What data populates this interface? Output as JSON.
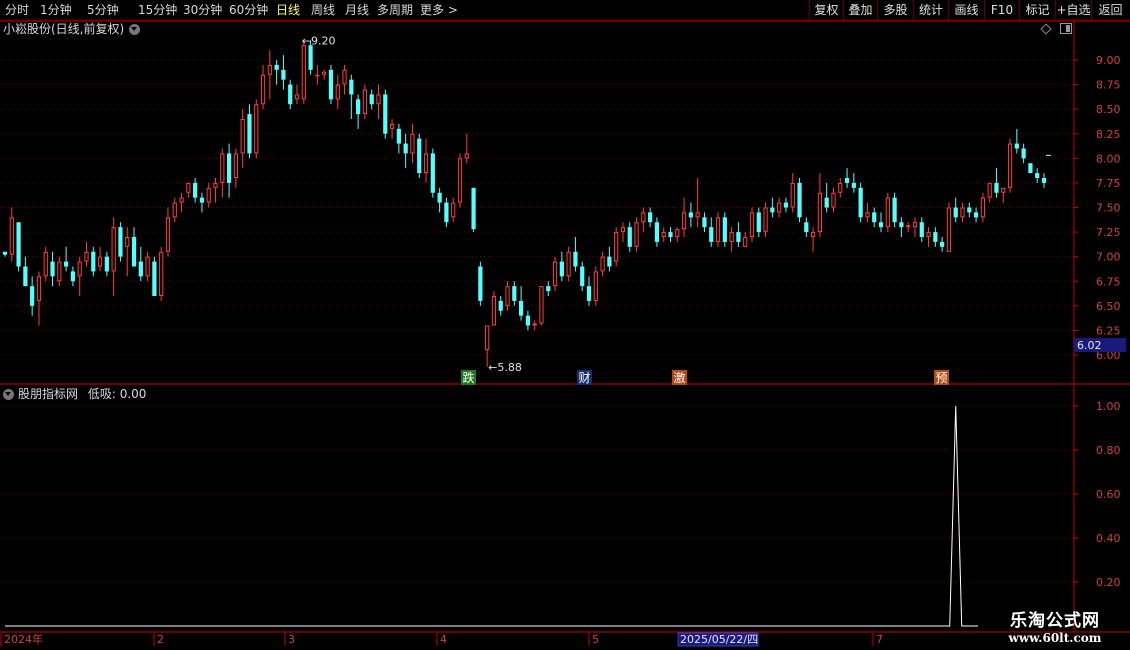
{
  "toolbar": {
    "periods": [
      {
        "label": "分时"
      },
      {
        "label": "1分钟"
      },
      {
        "label": "5分钟"
      },
      {
        "label": "15分钟"
      },
      {
        "label": "30分钟"
      },
      {
        "label": "60分钟"
      },
      {
        "label": "日线",
        "active": true
      },
      {
        "label": "周线"
      },
      {
        "label": "月线"
      },
      {
        "label": "多周期"
      },
      {
        "label": "更多 >"
      }
    ],
    "right_buttons": [
      {
        "label": "复权"
      },
      {
        "label": "叠加"
      },
      {
        "label": "多股"
      },
      {
        "label": "统计"
      },
      {
        "label": "画线"
      },
      {
        "label": "F10"
      },
      {
        "label": "标记"
      },
      {
        "label": "+自选"
      },
      {
        "label": "返回"
      }
    ]
  },
  "main_panel": {
    "title": "小崧股份(日线,前复权)",
    "high_label": "9.20",
    "low_label": "5.88",
    "current_price_tag": "6.02",
    "markers": [
      {
        "text": "跌",
        "bg": "#1f7a1f"
      },
      {
        "text": "财",
        "bg": "#1a2f6a"
      },
      {
        "text": "激",
        "bg": "#b54a10"
      },
      {
        "text": "预",
        "bg": "#b54a10"
      }
    ]
  },
  "indicator_panel": {
    "title": "股朋指标网",
    "value_text": "低吸: 0.00"
  },
  "date_axis": {
    "labels": [
      "2024年",
      "2",
      "3",
      "4",
      "5",
      "7"
    ],
    "cursor_date": "2025/05/22/四"
  },
  "watermark": {
    "main": "乐淘公式网",
    "sub": "www.60lt.com"
  },
  "colors": {
    "up": "#ff3c3c",
    "down": "#54ffff",
    "axis": "#c80000",
    "grid": "#6e0000",
    "highlight": "#ffff55",
    "price_tag_bg": "#1a1a7a"
  },
  "chart_data": [
    {
      "type": "candlestick",
      "title": "小崧股份(日线,前复权)",
      "ylim": [
        5.85,
        9.35
      ],
      "y_ticks": [
        9.0,
        8.75,
        8.5,
        8.25,
        8.0,
        7.75,
        7.5,
        7.25,
        7.0,
        6.75,
        6.5,
        6.25,
        6.0
      ],
      "candles": [
        [
          7.05,
          7.05,
          7.0,
          7.02
        ],
        [
          7.02,
          7.5,
          6.95,
          7.4
        ],
        [
          7.35,
          7.35,
          6.85,
          6.9
        ],
        [
          6.9,
          7.0,
          6.7,
          6.7
        ],
        [
          6.7,
          6.8,
          6.4,
          6.5
        ],
        [
          6.55,
          6.85,
          6.3,
          6.8
        ],
        [
          6.8,
          7.1,
          6.75,
          7.05
        ],
        [
          6.95,
          7.05,
          6.7,
          6.8
        ],
        [
          6.75,
          7.0,
          6.7,
          6.95
        ],
        [
          6.95,
          7.1,
          6.85,
          6.9
        ],
        [
          6.85,
          6.9,
          6.7,
          6.75
        ],
        [
          6.8,
          7.0,
          6.6,
          6.95
        ],
        [
          6.95,
          7.15,
          6.9,
          7.05
        ],
        [
          7.05,
          7.1,
          6.8,
          6.85
        ],
        [
          6.9,
          7.1,
          6.85,
          7.0
        ],
        [
          7.0,
          7.05,
          6.8,
          6.85
        ],
        [
          6.85,
          7.4,
          6.6,
          7.3
        ],
        [
          7.3,
          7.35,
          6.95,
          7.0
        ],
        [
          7.1,
          7.3,
          6.8,
          7.2
        ],
        [
          7.2,
          7.3,
          6.9,
          6.9
        ],
        [
          6.95,
          7.1,
          6.75,
          6.8
        ],
        [
          6.8,
          7.05,
          6.75,
          7.0
        ],
        [
          6.95,
          7.0,
          6.6,
          6.6
        ],
        [
          6.6,
          7.1,
          6.55,
          7.05
        ],
        [
          7.05,
          7.5,
          7.0,
          7.4
        ],
        [
          7.4,
          7.6,
          7.35,
          7.55
        ],
        [
          7.55,
          7.65,
          7.45,
          7.6
        ],
        [
          7.65,
          7.75,
          7.6,
          7.75
        ],
        [
          7.75,
          7.8,
          7.55,
          7.6
        ],
        [
          7.6,
          7.65,
          7.45,
          7.55
        ],
        [
          7.55,
          7.75,
          7.5,
          7.7
        ],
        [
          7.7,
          7.8,
          7.55,
          7.75
        ],
        [
          7.75,
          8.1,
          7.6,
          8.05
        ],
        [
          8.05,
          8.15,
          7.6,
          7.75
        ],
        [
          7.8,
          8.1,
          7.7,
          8.05
        ],
        [
          8.05,
          8.5,
          7.9,
          8.4
        ],
        [
          8.45,
          8.55,
          8.0,
          8.05
        ],
        [
          8.05,
          8.6,
          8.0,
          8.55
        ],
        [
          8.55,
          8.95,
          8.5,
          8.85
        ],
        [
          8.85,
          9.1,
          8.6,
          8.95
        ],
        [
          8.95,
          9.0,
          8.75,
          8.9
        ],
        [
          8.9,
          9.05,
          8.7,
          8.8
        ],
        [
          8.75,
          8.8,
          8.5,
          8.55
        ],
        [
          8.6,
          8.75,
          8.55,
          8.65
        ],
        [
          8.6,
          9.2,
          8.55,
          9.15
        ],
        [
          9.15,
          9.2,
          8.85,
          8.9
        ],
        [
          8.85,
          8.95,
          8.75,
          8.85
        ],
        [
          8.85,
          8.9,
          8.8,
          8.88
        ],
        [
          8.9,
          8.95,
          8.55,
          8.6
        ],
        [
          8.6,
          8.85,
          8.5,
          8.75
        ],
        [
          8.75,
          8.95,
          8.65,
          8.9
        ],
        [
          8.8,
          8.85,
          8.4,
          8.65
        ],
        [
          8.6,
          8.65,
          8.3,
          8.45
        ],
        [
          8.45,
          8.75,
          8.4,
          8.7
        ],
        [
          8.65,
          8.7,
          8.5,
          8.55
        ],
        [
          8.55,
          8.75,
          8.4,
          8.65
        ],
        [
          8.65,
          8.7,
          8.2,
          8.25
        ],
        [
          8.3,
          8.4,
          8.2,
          8.35
        ],
        [
          8.3,
          8.35,
          8.05,
          8.15
        ],
        [
          8.15,
          8.25,
          7.9,
          8.05
        ],
        [
          8.05,
          8.35,
          7.95,
          8.25
        ],
        [
          8.2,
          8.25,
          7.8,
          7.85
        ],
        [
          7.85,
          8.2,
          7.75,
          8.05
        ],
        [
          8.05,
          8.1,
          7.6,
          7.65
        ],
        [
          7.65,
          7.7,
          7.45,
          7.55
        ],
        [
          7.55,
          7.6,
          7.3,
          7.35
        ],
        [
          7.4,
          7.6,
          7.35,
          7.55
        ],
        [
          7.55,
          8.05,
          7.5,
          8.0
        ],
        [
          8.0,
          8.25,
          7.95,
          8.05
        ],
        [
          7.7,
          7.7,
          7.25,
          7.28
        ],
        [
          6.9,
          6.95,
          6.5,
          6.55
        ],
        [
          6.05,
          6.3,
          5.88,
          6.3
        ],
        [
          6.3,
          6.65,
          6.3,
          6.6
        ],
        [
          6.55,
          6.6,
          6.4,
          6.45
        ],
        [
          6.5,
          6.75,
          6.45,
          6.7
        ],
        [
          6.7,
          6.75,
          6.5,
          6.55
        ],
        [
          6.55,
          6.7,
          6.35,
          6.4
        ],
        [
          6.4,
          6.45,
          6.25,
          6.3
        ],
        [
          6.3,
          6.35,
          6.25,
          6.32
        ],
        [
          6.32,
          6.7,
          6.3,
          6.7
        ],
        [
          6.7,
          6.75,
          6.6,
          6.65
        ],
        [
          6.7,
          7.0,
          6.65,
          6.95
        ],
        [
          6.95,
          7.05,
          6.75,
          6.8
        ],
        [
          6.8,
          7.1,
          6.75,
          7.05
        ],
        [
          7.05,
          7.2,
          6.85,
          6.9
        ],
        [
          6.9,
          6.95,
          6.65,
          6.7
        ],
        [
          6.7,
          6.8,
          6.5,
          6.55
        ],
        [
          6.55,
          6.9,
          6.5,
          6.85
        ],
        [
          6.85,
          7.05,
          6.8,
          7.0
        ],
        [
          7.0,
          7.1,
          6.85,
          6.9
        ],
        [
          6.95,
          7.3,
          6.9,
          7.25
        ],
        [
          7.25,
          7.35,
          7.15,
          7.3
        ],
        [
          7.3,
          7.35,
          7.05,
          7.1
        ],
        [
          7.1,
          7.4,
          7.05,
          7.35
        ],
        [
          7.35,
          7.5,
          7.25,
          7.45
        ],
        [
          7.45,
          7.5,
          7.3,
          7.35
        ],
        [
          7.35,
          7.4,
          7.1,
          7.15
        ],
        [
          7.2,
          7.3,
          7.15,
          7.25
        ],
        [
          7.25,
          7.3,
          7.15,
          7.2
        ],
        [
          7.2,
          7.3,
          7.15,
          7.28
        ],
        [
          7.28,
          7.6,
          7.2,
          7.45
        ],
        [
          7.45,
          7.55,
          7.3,
          7.4
        ],
        [
          7.4,
          7.8,
          7.3,
          7.45
        ],
        [
          7.4,
          7.45,
          7.25,
          7.3
        ],
        [
          7.3,
          7.4,
          7.1,
          7.15
        ],
        [
          7.15,
          7.45,
          7.1,
          7.4
        ],
        [
          7.4,
          7.45,
          7.1,
          7.15
        ],
        [
          7.15,
          7.3,
          7.05,
          7.25
        ],
        [
          7.25,
          7.35,
          7.1,
          7.15
        ],
        [
          7.1,
          7.25,
          7.1,
          7.2
        ],
        [
          7.2,
          7.5,
          7.15,
          7.45
        ],
        [
          7.45,
          7.5,
          7.2,
          7.25
        ],
        [
          7.25,
          7.55,
          7.2,
          7.5
        ],
        [
          7.5,
          7.6,
          7.4,
          7.45
        ],
        [
          7.45,
          7.6,
          7.4,
          7.55
        ],
        [
          7.55,
          7.6,
          7.45,
          7.5
        ],
        [
          7.5,
          7.85,
          7.45,
          7.75
        ],
        [
          7.75,
          7.8,
          7.35,
          7.4
        ],
        [
          7.35,
          7.4,
          7.2,
          7.25
        ],
        [
          7.2,
          7.3,
          7.05,
          7.25
        ],
        [
          7.25,
          7.85,
          7.2,
          7.65
        ],
        [
          7.6,
          7.75,
          7.45,
          7.5
        ],
        [
          7.5,
          7.7,
          7.45,
          7.65
        ],
        [
          7.65,
          7.8,
          7.6,
          7.75
        ],
        [
          7.8,
          7.9,
          7.7,
          7.75
        ],
        [
          7.75,
          7.85,
          7.65,
          7.7
        ],
        [
          7.7,
          7.75,
          7.35,
          7.4
        ],
        [
          7.4,
          7.55,
          7.35,
          7.45
        ],
        [
          7.45,
          7.5,
          7.3,
          7.35
        ],
        [
          7.35,
          7.45,
          7.25,
          7.3
        ],
        [
          7.3,
          7.65,
          7.25,
          7.6
        ],
        [
          7.6,
          7.65,
          7.3,
          7.35
        ],
        [
          7.35,
          7.4,
          7.2,
          7.3
        ],
        [
          7.3,
          7.35,
          7.25,
          7.32
        ],
        [
          7.3,
          7.4,
          7.2,
          7.35
        ],
        [
          7.35,
          7.4,
          7.15,
          7.2
        ],
        [
          7.2,
          7.3,
          7.1,
          7.25
        ],
        [
          7.25,
          7.3,
          7.1,
          7.15
        ],
        [
          7.15,
          7.2,
          7.05,
          7.1
        ],
        [
          7.05,
          7.55,
          7.05,
          7.5
        ],
        [
          7.5,
          7.6,
          7.35,
          7.4
        ],
        [
          7.4,
          7.55,
          7.35,
          7.5
        ],
        [
          7.5,
          7.55,
          7.4,
          7.45
        ],
        [
          7.45,
          7.5,
          7.35,
          7.4
        ],
        [
          7.4,
          7.65,
          7.35,
          7.6
        ],
        [
          7.6,
          7.75,
          7.55,
          7.75
        ],
        [
          7.75,
          7.9,
          7.6,
          7.65
        ],
        [
          7.65,
          7.7,
          7.55,
          7.7
        ],
        [
          7.7,
          8.2,
          7.65,
          8.15
        ],
        [
          8.15,
          8.3,
          8.05,
          8.1
        ],
        [
          8.1,
          8.15,
          7.95,
          8.0
        ],
        [
          7.95,
          7.95,
          7.85,
          7.85
        ],
        [
          7.85,
          7.9,
          7.75,
          7.8
        ],
        [
          7.8,
          7.85,
          7.7,
          7.75
        ]
      ]
    },
    {
      "type": "line",
      "title": "股朋指标网",
      "ylim": [
        0,
        1.05
      ],
      "y_ticks": [
        1.0,
        0.8,
        0.6,
        0.4,
        0.2
      ],
      "series": [
        {
          "name": "低吸",
          "signal_index": 140,
          "spike_value": 1.0,
          "baseline": 0.0
        }
      ]
    }
  ]
}
